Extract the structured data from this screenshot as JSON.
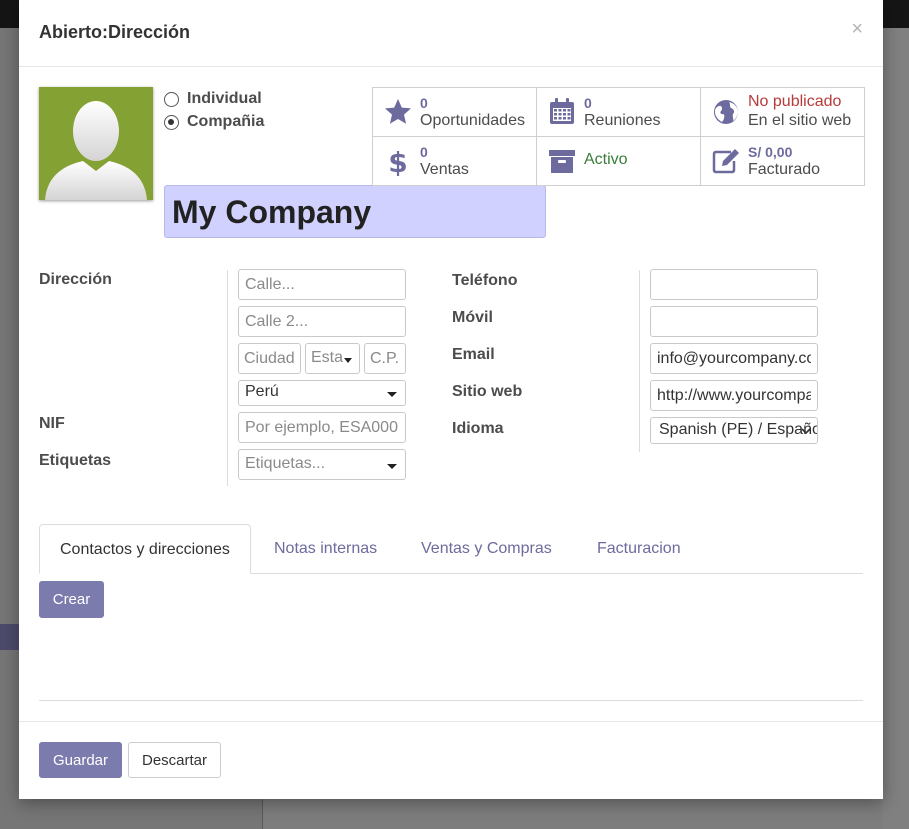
{
  "modal": {
    "title": "Abierto:Dirección",
    "close": "×"
  },
  "company_type": {
    "individual": "Individual",
    "company": "Compañia",
    "selected": "company"
  },
  "name": "My Company",
  "smart_buttons": {
    "opportunities": {
      "count": "0",
      "label": "Oportunidades",
      "icon": "star-icon"
    },
    "meetings": {
      "count": "0",
      "label": "Reuniones",
      "icon": "calendar-icon"
    },
    "website": {
      "status": "No publicado",
      "label": "En el sitio web",
      "icon": "globe-icon"
    },
    "sales": {
      "count": "0",
      "label": "Ventas",
      "icon": "dollar-icon"
    },
    "active": {
      "label": "Activo",
      "icon": "archive-icon"
    },
    "invoiced": {
      "amount": "S/ 0,00",
      "label": "Facturado",
      "icon": "edit-icon"
    }
  },
  "address": {
    "label": "Dirección",
    "street_placeholder": "Calle...",
    "street2_placeholder": "Calle 2...",
    "city_placeholder": "Ciudad",
    "state_placeholder": "Esta",
    "zip_placeholder": "C.P.",
    "country": "Perú"
  },
  "vat": {
    "label": "NIF",
    "placeholder": "Por ejemplo, ESA000"
  },
  "tags": {
    "label": "Etiquetas",
    "placeholder": "Etiquetas..."
  },
  "contact": {
    "phone_label": "Teléfono",
    "phone_value": "",
    "mobile_label": "Móvil",
    "mobile_value": "",
    "email_label": "Email",
    "email_value": "info@yourcompany.com",
    "website_label": "Sitio web",
    "website_value": "http://www.yourcompany.com",
    "lang_label": "Idioma",
    "lang_value": "Spanish (PE) / Español (PE)"
  },
  "tabs": [
    {
      "label": "Contactos y direcciones",
      "active": true
    },
    {
      "label": "Notas internas",
      "active": false
    },
    {
      "label": "Ventas y Compras",
      "active": false
    },
    {
      "label": "Facturacion",
      "active": false
    }
  ],
  "create_button": "Crear",
  "footer": {
    "save": "Guardar",
    "discard": "Descartar"
  },
  "colors": {
    "primary": "#7c7bad",
    "name_bg": "#d0d1fe",
    "avatar_bg": "#84a234",
    "active_green": "#3a7d3a",
    "unpublished_red": "#b73a3a"
  }
}
